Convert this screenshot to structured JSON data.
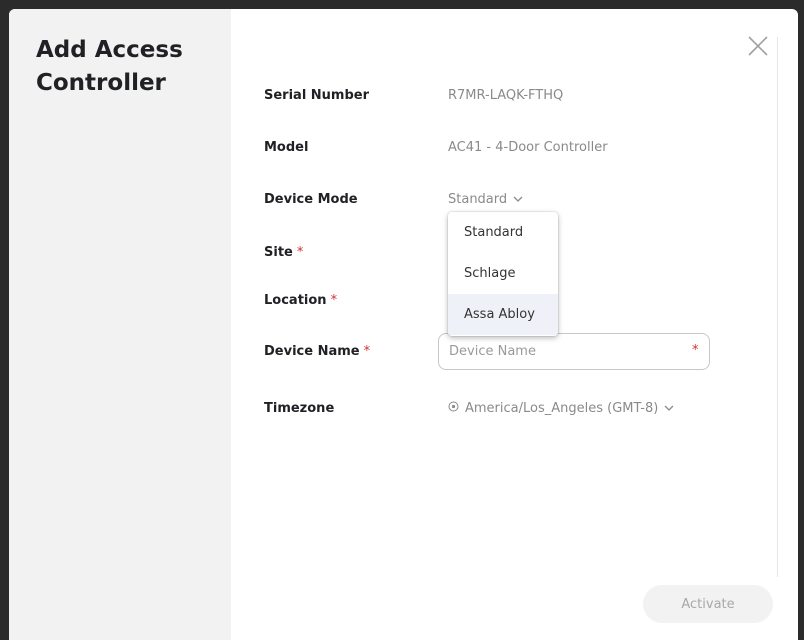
{
  "modal": {
    "title": "Add Access Controller"
  },
  "form": {
    "serial_number": {
      "label": "Serial Number",
      "value": "R7MR-LAQK-FTHQ"
    },
    "model": {
      "label": "Model",
      "value": "AC41 - 4-Door Controller"
    },
    "device_mode": {
      "label": "Device Mode",
      "value": "Standard"
    },
    "site": {
      "label": "Site",
      "required_mark": "*"
    },
    "location": {
      "label": "Location",
      "required_mark": "*"
    },
    "device_name": {
      "label": "Device Name",
      "required_mark": "*",
      "placeholder": "Device Name",
      "value": ""
    },
    "timezone": {
      "label": "Timezone",
      "value": "America/Los_Angeles (GMT-8)"
    }
  },
  "device_mode_dropdown": {
    "options": [
      "Standard",
      "Schlage",
      "Assa Abloy"
    ],
    "hovered_index": 2
  },
  "footer": {
    "activate_label": "Activate"
  },
  "icons": {
    "close": "close-icon",
    "chevron": "chevron-down-icon",
    "timezone": "globe-icon"
  },
  "colors": {
    "required": "#d0312d",
    "muted_text": "#8a8a8a",
    "sidebar_bg": "#f2f2f2",
    "hover_bg": "#eef2f8"
  }
}
